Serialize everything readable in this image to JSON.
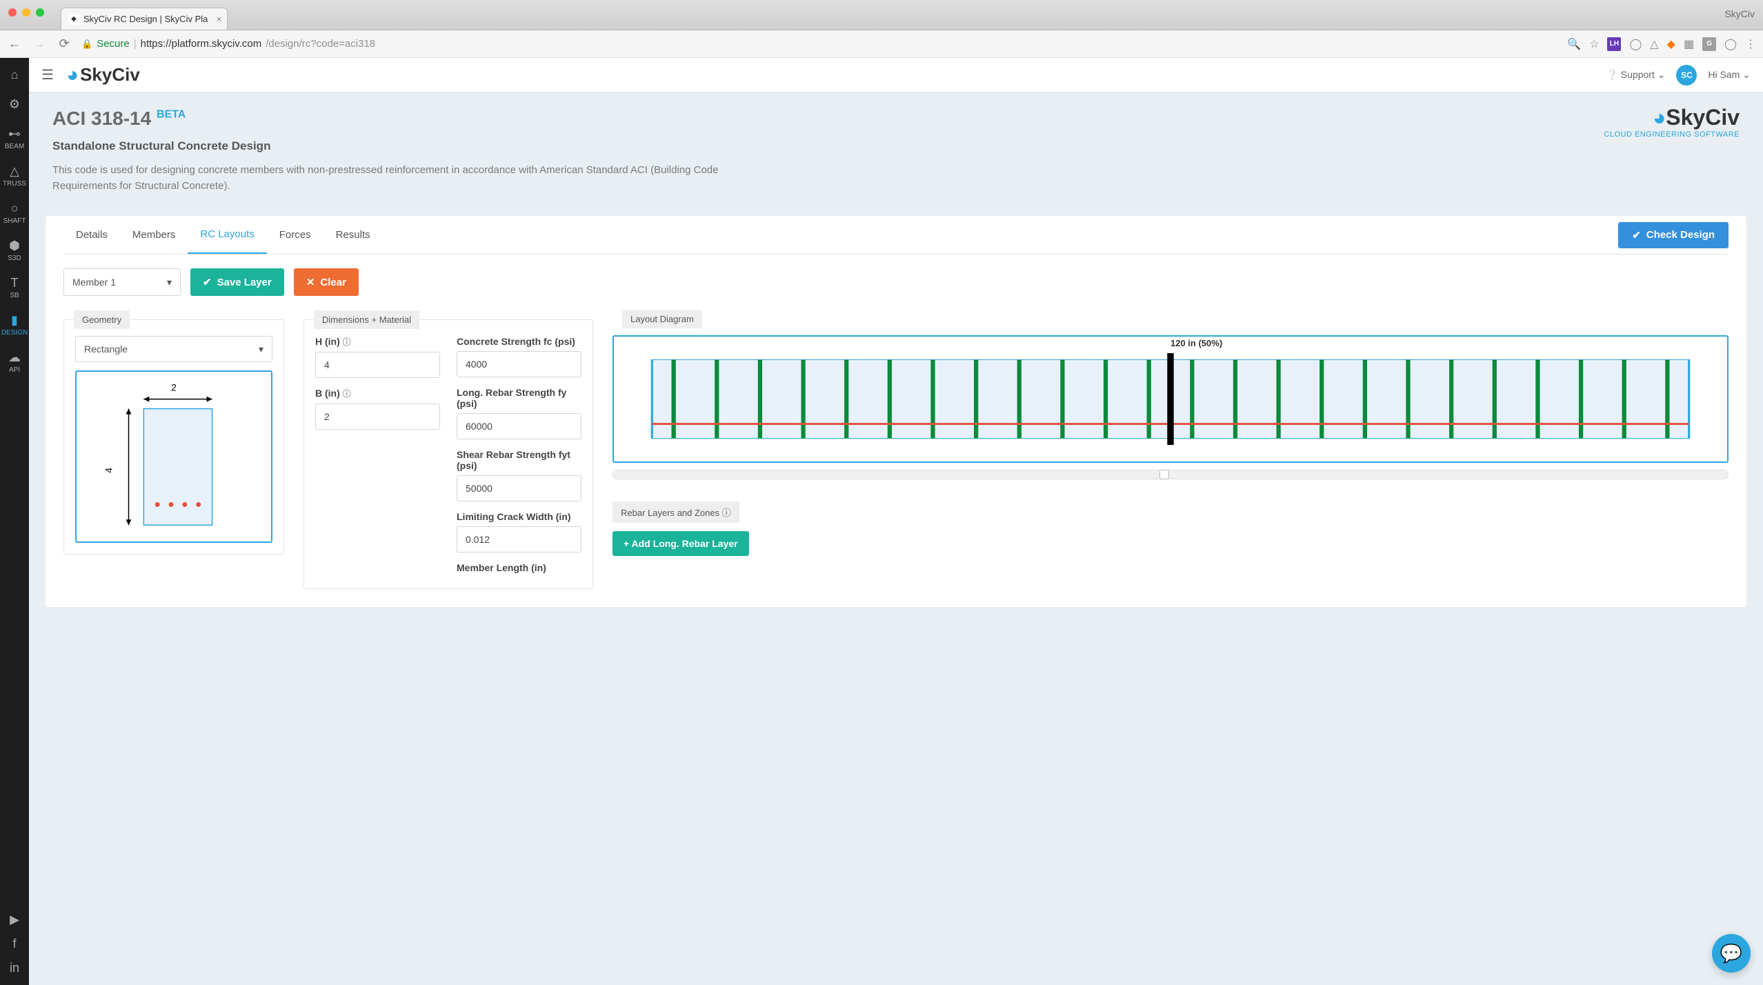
{
  "browser": {
    "tab_title": "SkyCiv RC Design | SkyCiv Pla",
    "secure_label": "Secure",
    "url_host": "https://platform.skyciv.com",
    "url_path": "/design/rc?code=aci318",
    "app_label": "SkyCiv"
  },
  "rail": {
    "beam": "BEAM",
    "truss": "TRUSS",
    "shaft": "SHAFT",
    "s3d": "S3D",
    "sb": "SB",
    "design": "DESIGN",
    "api": "API"
  },
  "header": {
    "logo": "SkyCiv",
    "support": "Support",
    "avatar_initials": "SC",
    "greeting": "Hi Sam"
  },
  "intro": {
    "title": "ACI 318-14",
    "badge": "BETA",
    "subtitle": "Standalone Structural Concrete Design",
    "description": "This code is used for designing concrete members with non-prestressed reinforcement in accordance with American Standard ACI (Building Code Requirements for Structural Concrete).",
    "brand_name": "SkyCiv",
    "brand_tag": "CLOUD ENGINEERING SOFTWARE"
  },
  "tabs": {
    "details": "Details",
    "members": "Members",
    "rc_layouts": "RC Layouts",
    "forces": "Forces",
    "results": "Results",
    "check_design": "Check Design"
  },
  "toolbar": {
    "member_select": "Member 1",
    "save_layer": "Save Layer",
    "clear": "Clear"
  },
  "panels": {
    "geometry_title": "Geometry",
    "dimensions_title": "Dimensions + Material",
    "layout_title": "Layout Diagram",
    "rebar_title": "Rebar Layers and Zones"
  },
  "geometry": {
    "shape": "Rectangle",
    "width_label": "2",
    "height_label": "4"
  },
  "fields": {
    "h_label": "H (in)",
    "h_value": "4",
    "b_label": "B (in)",
    "b_value": "2",
    "fc_label": "Concrete Strength fc (psi)",
    "fc_value": "4000",
    "fy_label": "Long. Rebar Strength fy (psi)",
    "fy_value": "60000",
    "fyt_label": "Shear Rebar Strength fyt (psi)",
    "fyt_value": "50000",
    "crack_label": "Limiting Crack Width (in)",
    "crack_value": "0.012",
    "length_label": "Member Length (in)"
  },
  "layout_diagram": {
    "marker": "120 in (50%)"
  },
  "rebar": {
    "add_button": "+   Add Long. Rebar Layer"
  }
}
